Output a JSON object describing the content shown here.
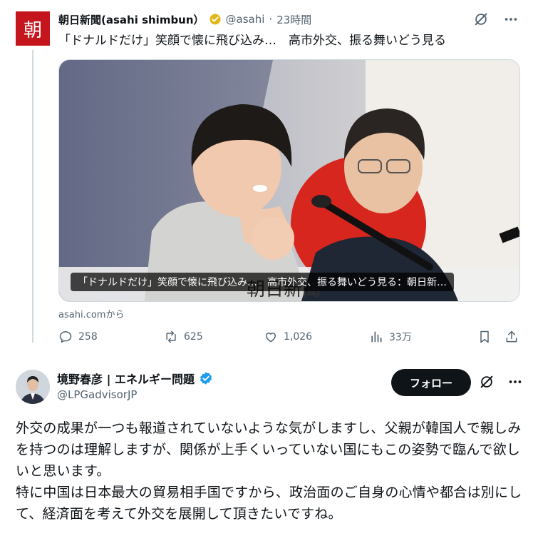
{
  "post": {
    "avatar_char": "朝",
    "author_name": "朝日新聞(asahi shimbun）",
    "handle": "@asahi",
    "separator": "·",
    "time": "23時間",
    "headline": "「ドナルドだけ」笑顔で懐に飛び込み…　高市外交、振る舞いどう見る",
    "card_caption": "「ドナルドだけ」笑顔で懐に飛び込み…　高市外交、振る舞いどう見る：朝日新…",
    "card_watermark": "朝日新聞",
    "source_domain": "asahi.comから",
    "stats": {
      "replies": "258",
      "reposts": "625",
      "likes": "1,026",
      "views": "33万"
    }
  },
  "reply": {
    "author_name": "境野春彦 | エネルギー問題",
    "handle": "@LPGadvisorJP",
    "follow_label": "フォロー",
    "text": "外交の成果が一つも報道されていないような気がしますし、父親が韓国人で親しみを持つのは理解しますが、関係が上手くいっていない国にもこの姿勢で臨んで欲しいと思います。\n特に中国は日本最大の貿易相手国ですから、政治面のご自身の心情や都合は別にして、経済面を考えて外交を展開して頂きたいですね。"
  },
  "colors": {
    "asahi_red": "#c4161c",
    "verified_gold": "#e2b719",
    "verified_blue": "#1d9bf0",
    "muted": "#536471"
  },
  "icons": [
    "more-icon",
    "grok-icon",
    "reply-icon",
    "repost-icon",
    "like-icon",
    "views-icon",
    "bookmark-icon",
    "share-icon",
    "verified-gold-icon",
    "verified-blue-icon"
  ]
}
